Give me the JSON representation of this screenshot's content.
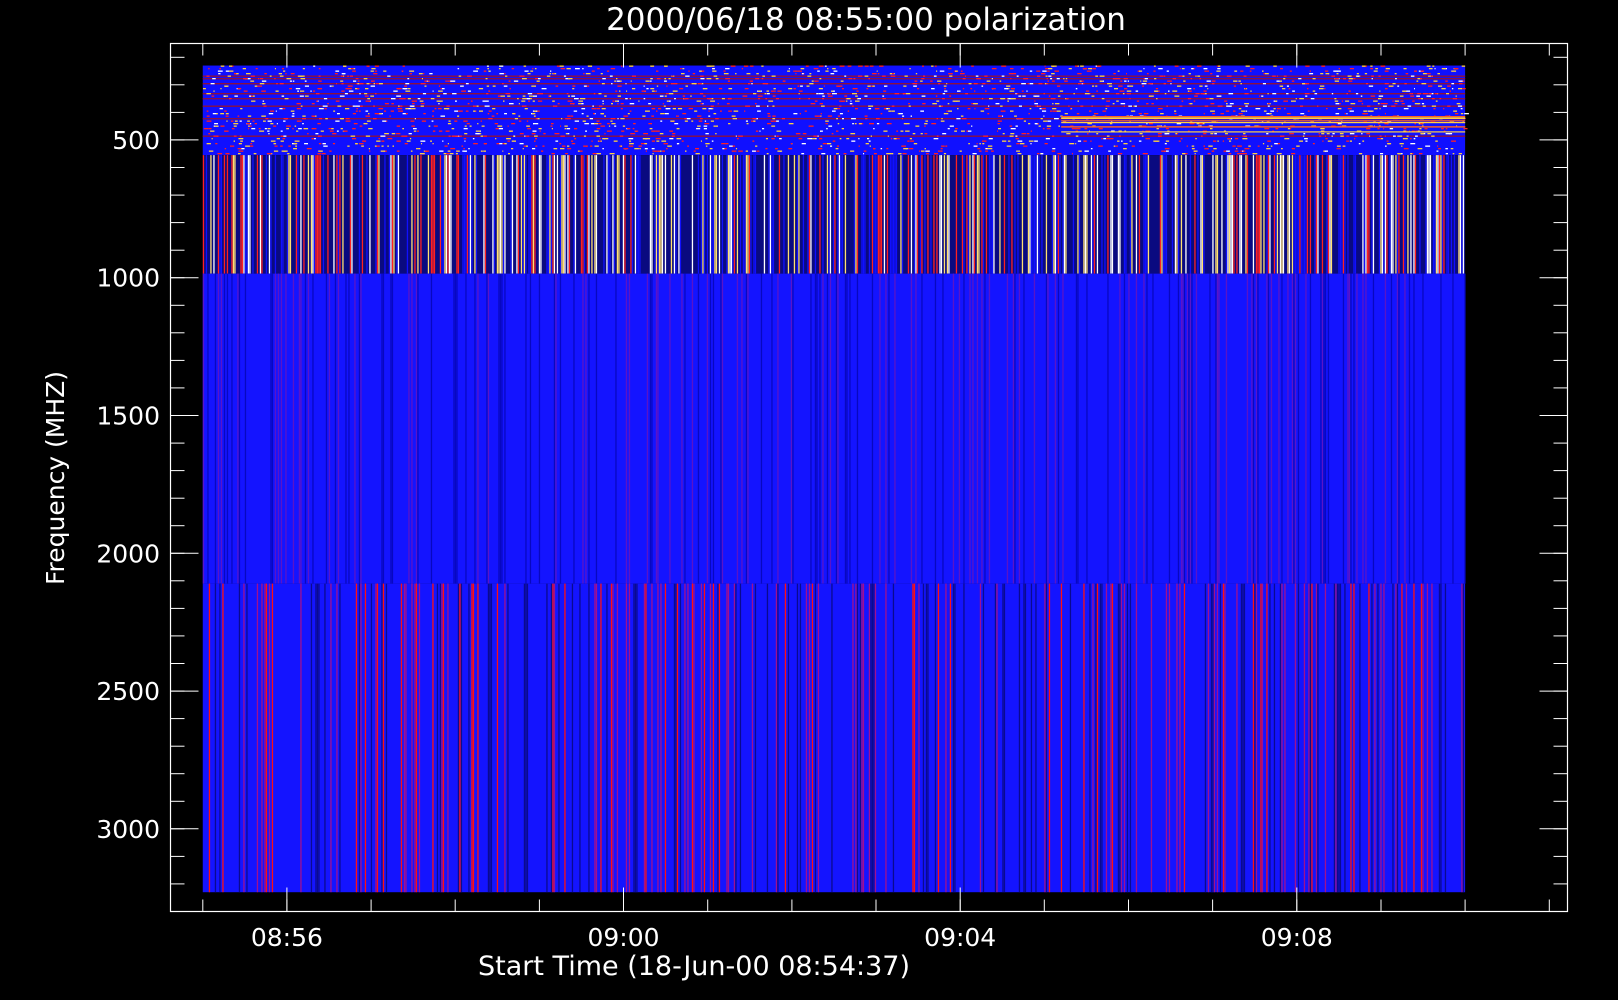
{
  "chart_data": {
    "type": "heatmap",
    "title": "2000/06/18 08:55:00 polarization",
    "xlabel": "Start Time (18-Jun-00 08:54:37)",
    "ylabel": "Frequency (MHZ)",
    "xlim": [
      "08:54:37",
      "09:11:13"
    ],
    "ylim": [
      3300,
      150
    ],
    "y_inverted": true,
    "x_tick_labels": [
      "08:56",
      "09:00",
      "09:04",
      "09:08"
    ],
    "x_tick_values": [
      "08:56:00",
      "09:00:00",
      "09:04:00",
      "09:08:00"
    ],
    "x_minor_step_seconds": 60,
    "y_tick_labels": [
      "500",
      "1000",
      "1500",
      "2000",
      "2500",
      "3000"
    ],
    "y_tick_values": [
      500,
      1000,
      1500,
      2000,
      2500,
      3000
    ],
    "y_minor_step": 100,
    "data_time_range": [
      "08:55:00",
      "09:10:00"
    ],
    "bands": [
      {
        "name": "band-1",
        "freq_range": [
          230,
          555
        ],
        "texture": "speckle",
        "dominant_color": "#1010ff",
        "accent_colors": [
          "#ff2020",
          "#ffd040",
          "#ffffff"
        ]
      },
      {
        "name": "band-2",
        "freq_range": [
          555,
          985
        ],
        "texture": "vertical-stripes",
        "dominant_color": "#0a0a80",
        "accent_colors": [
          "#ffffff",
          "#ffe070",
          "#ff2020",
          "#1010ff"
        ]
      },
      {
        "name": "band-3",
        "freq_range": [
          985,
          2110
        ],
        "texture": "vertical-stripes",
        "dominant_color": "#1414ff",
        "accent_colors": [
          "#5a14c8",
          "#0808c0"
        ]
      },
      {
        "name": "band-4",
        "freq_range": [
          2110,
          3230
        ],
        "texture": "vertical-stripes",
        "dominant_color": "#1414ff",
        "accent_colors": [
          "#ff1010",
          "#a01090",
          "#0a0a90"
        ]
      }
    ],
    "colors": {
      "background": "#000000",
      "axes": "#ffffff",
      "text": "#ffffff"
    }
  }
}
